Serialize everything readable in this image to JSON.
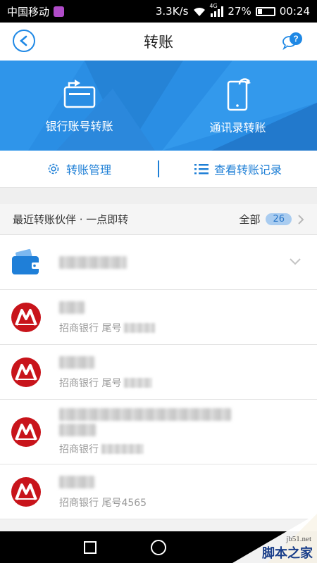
{
  "status_bar": {
    "carrier": "中国移动",
    "speed": "3.3K/s",
    "network": "4G",
    "battery": "27%",
    "battery_level": 0.27,
    "time": "00:24"
  },
  "header": {
    "title": "转账",
    "back_icon": "back-icon",
    "help_icon": "chat-help-icon"
  },
  "banner": {
    "bank_transfer_label": "银行账号转账",
    "contacts_transfer_label": "通讯录转账",
    "bg_color": "#2a8ee4"
  },
  "toolbar": {
    "manage_label": "转账管理",
    "records_label": "查看转账记录",
    "accent": "#1e7fd6"
  },
  "recent": {
    "title": "最近转账伙伴 · 一点即转",
    "all_label": "全部",
    "count": "26"
  },
  "partners": [
    {
      "type": "wallet",
      "sub_prefix": ""
    },
    {
      "type": "cmb",
      "sub_prefix": "招商银行 尾号"
    },
    {
      "type": "cmb",
      "sub_prefix": "招商银行 尾号"
    },
    {
      "type": "cmb",
      "sub_prefix": "招商银行"
    },
    {
      "type": "cmb",
      "sub_prefix": "招商银行 尾号4565"
    }
  ],
  "watermark": {
    "site": "jb51.net",
    "brand": "脚本之家"
  }
}
